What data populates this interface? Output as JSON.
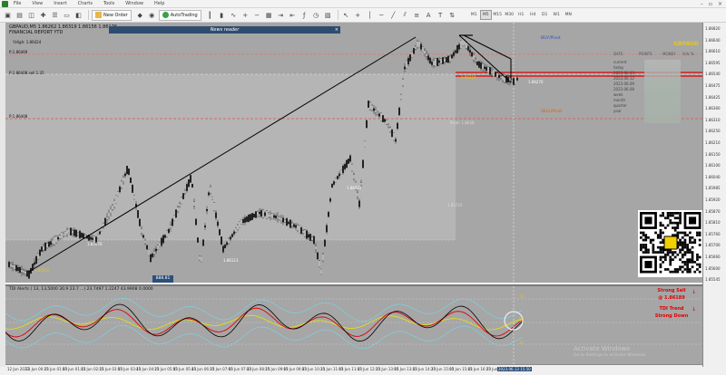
{
  "menubar": {
    "items": [
      "File",
      "View",
      "Insert",
      "Charts",
      "Tools",
      "Window",
      "Help"
    ]
  },
  "toolbar": {
    "new_order": "New Order",
    "autotrading": "AutoTrading",
    "timeframes": [
      "M1",
      "M5",
      "M15",
      "M30",
      "H1",
      "H4",
      "D1",
      "W1",
      "MN"
    ],
    "active_timeframe": "M5"
  },
  "chart": {
    "title_line1": "GBPAUD,M5 1.86262 1.86319 1.86156 1.86176",
    "title_line2": "FINANCIAL REPORT YTD",
    "news_reader": "News reader",
    "labels": {
      "yhigh": "Y.High: 1.86424",
      "p1": "P:1.86469",
      "sell_level": "P:1.86408 sell 1.35",
      "p2": "P:1.86408",
      "low_mid": "1.86223",
      "low_a": "1.85970",
      "low_b": "1.85810",
      "low_c": "1.86113",
      "low_d": "1.85723",
      "mark_a": "1.86310",
      "mark_b": "1.86270",
      "pivot_point": "Pivot: 1.8630"
    },
    "buy_pivot": "BUY/Pivot",
    "sell_pivot": "SELL/Pivot",
    "value_tag": "888.81"
  },
  "panel": {
    "symbol": "GBPAUD",
    "headers": [
      "DATE",
      "POINTS",
      "MONEY",
      "%% %"
    ],
    "rows": [
      "current",
      "today",
      "2023.06.13",
      "2023.06.12",
      "2023.06.09",
      "2023.06.08",
      "week",
      "month",
      "quarter",
      "year"
    ]
  },
  "price_scale": [
    "1.86820",
    "1.86640",
    "1.86610",
    "1.86595",
    "1.86540",
    "1.86475",
    "1.86425",
    "1.86360",
    "1.86310",
    "1.86250",
    "1.86210",
    "1.86150",
    "1.86100",
    "1.86040",
    "1.85985",
    "1.85920",
    "1.85870",
    "1.85810",
    "1.85760",
    "1.85700",
    "1.85660",
    "1.85600",
    "1.85545"
  ],
  "osc": {
    "title": "TDI Alerts ( 13, 13,5000 30.9 23.7 ...) 23.7497 1.2247 43.9908 0.0000",
    "levels": [
      "73",
      "50",
      "32"
    ]
  },
  "signals": {
    "strong_sell": "Strong Sell",
    "sell_price": "@ 1.86189",
    "tdi_trend": "TDI Trend",
    "strong_down": "Strong Down"
  },
  "time_axis": [
    "12 Jun 2023",
    "13 Jun 00:25",
    "13 Jun 01:05",
    "13 Jun 01:45",
    "13 Jun 02:25",
    "13 Jun 03:05",
    "13 Jun 03:45",
    "13 Jun 04:25",
    "13 Jun 05:05",
    "13 Jun 05:45",
    "13 Jun 06:25",
    "13 Jun 07:05",
    "13 Jun 07:45",
    "13 Jun 08:25",
    "13 Jun 09:05",
    "13 Jun 09:45",
    "13 Jun 10:25",
    "13 Jun 11:05",
    "13 Jun 11:45",
    "13 Jun 12:25",
    "13 Jun 13:05",
    "13 Jun 13:45",
    "13 Jun 14:25",
    "13 Jun 15:05",
    "13 Jun 15:45",
    "13 Jun 16:25",
    "13 Jun 17:05"
  ],
  "current_time": "2023.06.13 15:50",
  "watermark": "Activate Windows",
  "watermark_sub": "Go to Settings to activate Windows."
}
